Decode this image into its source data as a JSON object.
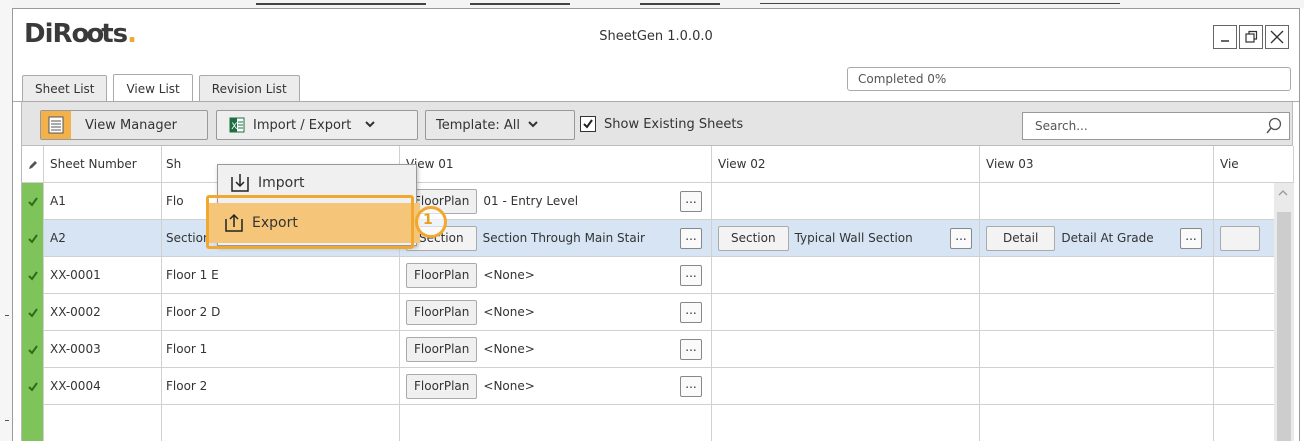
{
  "app": {
    "logo_text": "DiRoots",
    "title": "SheetGen 1.0.0.0"
  },
  "tabs": [
    {
      "label": "Sheet List"
    },
    {
      "label": "View List",
      "active": true
    },
    {
      "label": "Revision List"
    }
  ],
  "progress": {
    "text": "Completed 0%",
    "value": 0
  },
  "toolbar": {
    "view_manager": "View Manager",
    "import_export": "Import / Export",
    "template": "Template: All",
    "show_existing": "Show Existing Sheets",
    "show_existing_checked": true,
    "search_placeholder": "Search..."
  },
  "dropdown": {
    "import": "Import",
    "export": "Export"
  },
  "annotation": {
    "marker": "1"
  },
  "columns": [
    "Sheet Number",
    "Sh",
    "View 01",
    "View 02",
    "View 03",
    "Vie"
  ],
  "rows": [
    {
      "number": "A1",
      "name": "Flo",
      "v1_type": "FloorPlan",
      "v1_name": "01 - Entry Level",
      "v2_type": "",
      "v2_name": "",
      "v3_type": "",
      "v3_name": ""
    },
    {
      "number": "A2",
      "name": "Sections",
      "v1_type": "Section",
      "v1_name": "Section Through Main Stair",
      "v2_type": "Section",
      "v2_name": "Typical Wall Section",
      "v3_type": "Detail",
      "v3_name": "Detail At Grade",
      "selected": true
    },
    {
      "number": "XX-0001",
      "name": "Floor 1 E",
      "v1_type": "FloorPlan",
      "v1_name": "<None>"
    },
    {
      "number": "XX-0002",
      "name": "Floor 2 D",
      "v1_type": "FloorPlan",
      "v1_name": "<None>"
    },
    {
      "number": "XX-0003",
      "name": "Floor 1",
      "v1_type": "FloorPlan",
      "v1_name": "<None>"
    },
    {
      "number": "XX-0004",
      "name": "Floor 2",
      "v1_type": "FloorPlan",
      "v1_name": "<None>"
    }
  ],
  "ellipsis": "...",
  "colors": {
    "accent": "#f0a830",
    "check_green": "#7ec45a",
    "selected_row": "#d6e4f3",
    "export_highlight": "#f5c67a"
  }
}
